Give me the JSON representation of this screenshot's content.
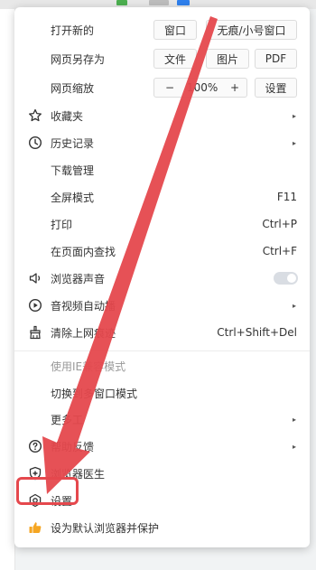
{
  "menu": {
    "row_open_new": {
      "label": "打开新的",
      "btn_window": "窗口",
      "btn_incognito": "无痕/小号窗口"
    },
    "row_save_as": {
      "label": "网页另存为",
      "btn_file": "文件",
      "btn_image": "图片",
      "btn_pdf": "PDF"
    },
    "row_zoom": {
      "label": "网页缩放",
      "minus": "−",
      "value": "100%",
      "plus": "+",
      "btn_settings": "设置"
    },
    "favorites": {
      "label": "收藏夹",
      "arrow": "▸"
    },
    "history": {
      "label": "历史记录",
      "arrow": "▸"
    },
    "downloads": {
      "label": "下载管理"
    },
    "fullscreen": {
      "label": "全屏模式",
      "shortcut": "F11"
    },
    "print": {
      "label": "打印",
      "shortcut": "Ctrl+P"
    },
    "find": {
      "label": "在页面内查找",
      "shortcut": "Ctrl+F"
    },
    "sound": {
      "label": "浏览器声音",
      "enabled": false
    },
    "autoplay": {
      "label": "音视频自动播",
      "arrow": "▸"
    },
    "clear": {
      "label": "清除上网痕迹",
      "shortcut": "Ctrl+Shift+Del"
    },
    "ie_mode": {
      "label": "使用IE兼容模式"
    },
    "multi_window": {
      "label": "切换到多窗口模式"
    },
    "more_tools": {
      "label": "更多工",
      "arrow": "▸"
    },
    "help": {
      "label": "帮助反馈",
      "arrow": "▸"
    },
    "doctor": {
      "label": "浏览器医生"
    },
    "settings": {
      "label": "设置"
    },
    "default_browser": {
      "label": "设为默认浏览器并保护"
    }
  },
  "colors": {
    "annotation_red": "#e5484d",
    "thumb_yellow": "#f5a623"
  }
}
